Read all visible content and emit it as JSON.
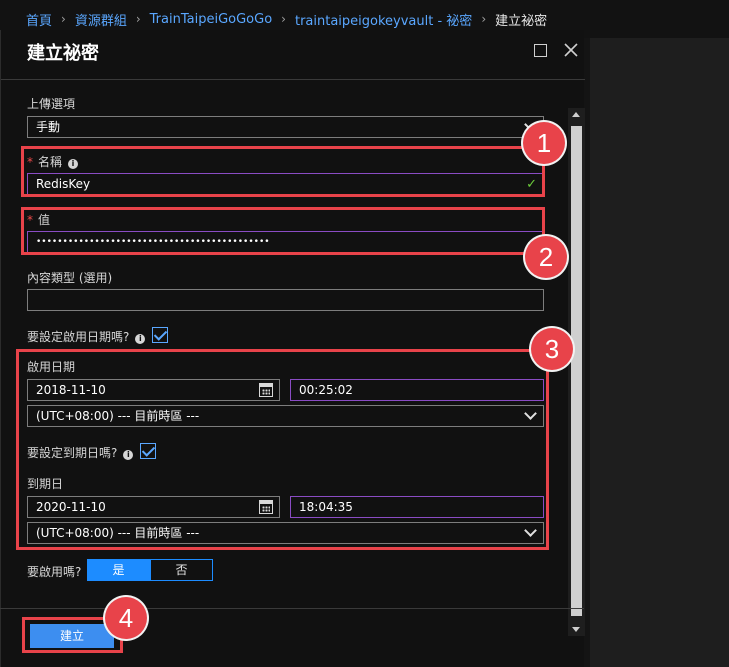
{
  "breadcrumb": {
    "items": [
      "首頁",
      "資源群組",
      "TrainTaipeiGoGoGo",
      "traintaipeigokeyvault - 祕密"
    ],
    "current": "建立祕密",
    "separator": "›"
  },
  "blade": {
    "title": "建立祕密"
  },
  "form": {
    "upload_label": "上傳選項",
    "upload_value": "手動",
    "name_label": "名稱",
    "name_value": "RedisKey",
    "value_label": "值",
    "value_masked": "••••••••••••••••••••••••••••••••••••••••••••",
    "content_type_label": "內容類型 (選用)",
    "content_type_value": "",
    "set_activation_label": "要設定啟用日期嗎?",
    "activation_date_label": "啟用日期",
    "activation_date": "2018-11-10",
    "activation_time": "00:25:02",
    "activation_tz": "(UTC+08:00) --- 目前時區 ---",
    "set_expiration_label": "要設定到期日嗎?",
    "expiration_date_label": "到期日",
    "expiration_date": "2020-11-10",
    "expiration_time": "18:04:35",
    "expiration_tz": "(UTC+08:00) --- 目前時區 ---",
    "enabled_label": "要啟用嗎?",
    "enabled_yes": "是",
    "enabled_no": "否"
  },
  "footer": {
    "create_label": "建立"
  },
  "annotations": {
    "badges": [
      "1",
      "2",
      "3",
      "4"
    ],
    "color": "#e8434a"
  },
  "colors": {
    "accent": "#1d8cff",
    "link": "#5aa7ff",
    "focus_border": "#8a4cc4",
    "valid_check": "#6ccb3b"
  }
}
